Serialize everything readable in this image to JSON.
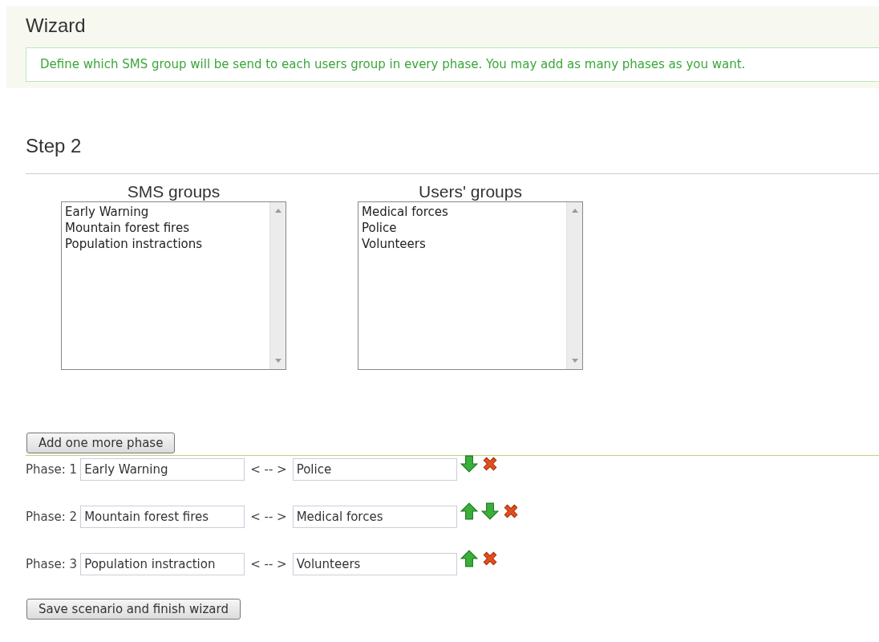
{
  "header": {
    "title": "Wizard",
    "info": "Define which SMS group will be send to each users group in every phase. You may add as many phases as you want."
  },
  "step": {
    "title": "Step 2"
  },
  "lists": [
    {
      "heading": "SMS groups",
      "items": [
        "Early Warning",
        "Mountain forest fires",
        "Population instractions"
      ]
    },
    {
      "heading": "Users' groups",
      "items": [
        "Medical forces",
        "Police",
        "Volunteers"
      ]
    }
  ],
  "add_button": "Add one more phase",
  "phases": [
    {
      "label": "Phase: 1",
      "sms_group": "Early Warning",
      "separator": "< -- >",
      "users_group": "Police",
      "can_move_up": false,
      "can_move_down": true
    },
    {
      "label": "Phase: 2",
      "sms_group": "Mountain forest fires",
      "separator": "< -- >",
      "users_group": "Medical forces",
      "can_move_up": true,
      "can_move_down": true
    },
    {
      "label": "Phase: 3",
      "sms_group": "Population instraction",
      "separator": "< -- >",
      "users_group": "Volunteers",
      "can_move_up": true,
      "can_move_down": false
    }
  ],
  "save_button": "Save scenario and finish wizard"
}
